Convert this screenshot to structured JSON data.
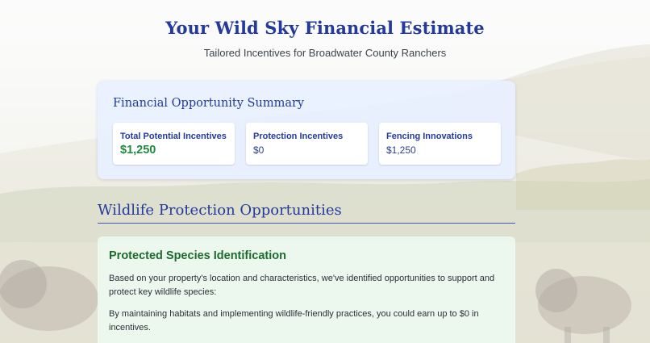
{
  "header": {
    "title": "Your Wild Sky Financial Estimate",
    "subtitle": "Tailored Incentives for Broadwater County Ranchers"
  },
  "summary": {
    "title": "Financial Opportunity Summary",
    "cards": [
      {
        "label": "Total Potential Incentives",
        "value": "$1,250"
      },
      {
        "label": "Protection Incentives",
        "value": "$0"
      },
      {
        "label": "Fencing Innovations",
        "value": "$1,250"
      }
    ]
  },
  "wildlife": {
    "heading": "Wildlife Protection Opportunities",
    "species": {
      "title": "Protected Species Identification",
      "paragraphs": [
        "Based on your property's location and characteristics, we've identified opportunities to support and protect key wildlife species:",
        "By maintaining habitats and implementing wildlife-friendly practices, you could earn up to $0 in incentives."
      ]
    }
  },
  "colors": {
    "accent": "#233a9c",
    "incentive_green": "#1f8a3c",
    "species_green": "#1c6b2e",
    "summary_panel_bg": "#e8f0ff",
    "species_panel_bg": "#ecf9ee"
  }
}
